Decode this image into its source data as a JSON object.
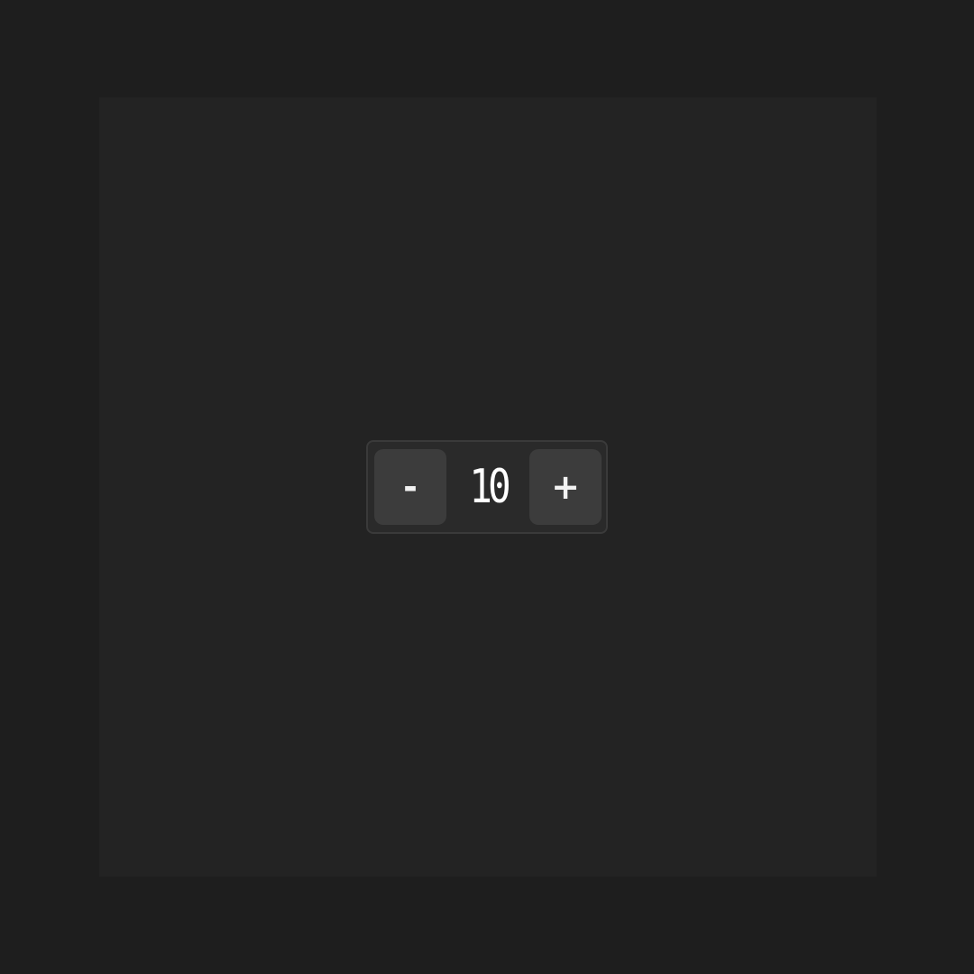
{
  "stepper": {
    "decrement_label": "-",
    "value": "10",
    "increment_label": "+"
  },
  "colors": {
    "background": "#1e1e1e",
    "panel": "#232323",
    "stepper_bg": "#2a2a2a",
    "button_bg": "#3c3c3c",
    "text": "#ffffff"
  }
}
